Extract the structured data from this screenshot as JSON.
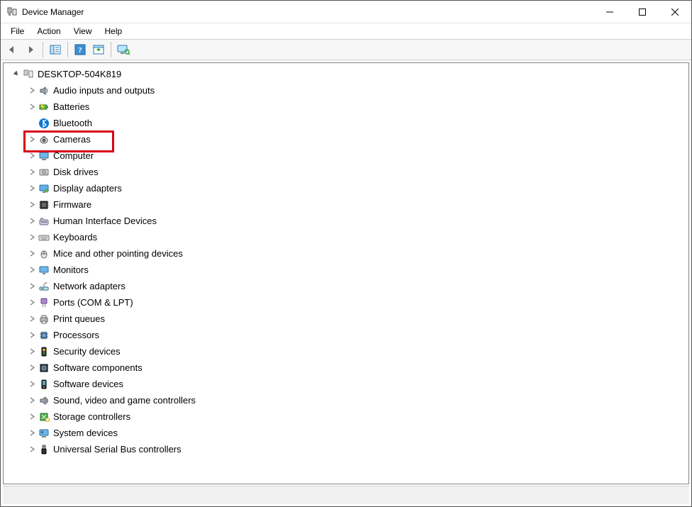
{
  "window": {
    "title": "Device Manager"
  },
  "menubar": {
    "file": "File",
    "action": "Action",
    "view": "View",
    "help": "Help"
  },
  "tree": {
    "root": "DESKTOP-504K819",
    "items": [
      {
        "label": "Audio inputs and outputs",
        "icon": "audio",
        "expander": true
      },
      {
        "label": "Batteries",
        "icon": "battery",
        "expander": true
      },
      {
        "label": "Bluetooth",
        "icon": "bluetooth",
        "expander": false
      },
      {
        "label": "Cameras",
        "icon": "camera",
        "expander": true,
        "highlighted": true
      },
      {
        "label": "Computer",
        "icon": "computer",
        "expander": true
      },
      {
        "label": "Disk drives",
        "icon": "disk",
        "expander": true
      },
      {
        "label": "Display adapters",
        "icon": "display",
        "expander": true
      },
      {
        "label": "Firmware",
        "icon": "firmware",
        "expander": true
      },
      {
        "label": "Human Interface Devices",
        "icon": "hid",
        "expander": true
      },
      {
        "label": "Keyboards",
        "icon": "keyboard",
        "expander": true
      },
      {
        "label": "Mice and other pointing devices",
        "icon": "mouse",
        "expander": true
      },
      {
        "label": "Monitors",
        "icon": "monitor",
        "expander": true
      },
      {
        "label": "Network adapters",
        "icon": "network",
        "expander": true
      },
      {
        "label": "Ports (COM & LPT)",
        "icon": "port",
        "expander": true
      },
      {
        "label": "Print queues",
        "icon": "printer",
        "expander": true
      },
      {
        "label": "Processors",
        "icon": "cpu",
        "expander": true
      },
      {
        "label": "Security devices",
        "icon": "security",
        "expander": true
      },
      {
        "label": "Software components",
        "icon": "swcomp",
        "expander": true
      },
      {
        "label": "Software devices",
        "icon": "swdev",
        "expander": true
      },
      {
        "label": "Sound, video and game controllers",
        "icon": "sound",
        "expander": true
      },
      {
        "label": "Storage controllers",
        "icon": "storage",
        "expander": true
      },
      {
        "label": "System devices",
        "icon": "system",
        "expander": true
      },
      {
        "label": "Universal Serial Bus controllers",
        "icon": "usb",
        "expander": true
      }
    ]
  }
}
